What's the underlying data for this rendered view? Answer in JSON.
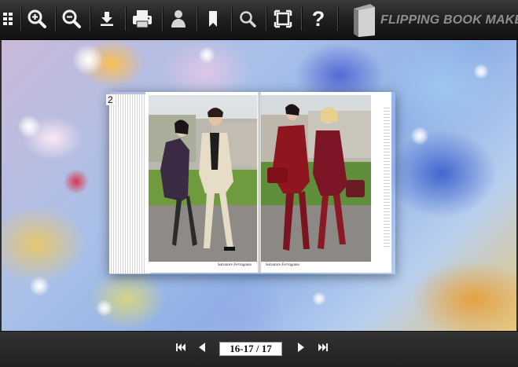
{
  "toolbar": {
    "buttons": [
      {
        "name": "thumbnails-icon"
      },
      {
        "name": "zoom-in-icon"
      },
      {
        "name": "zoom-out-icon"
      },
      {
        "name": "download-icon"
      },
      {
        "name": "print-icon"
      },
      {
        "name": "share-icon"
      },
      {
        "name": "bookmark-icon"
      },
      {
        "name": "search-icon"
      },
      {
        "name": "fullscreen-icon"
      },
      {
        "name": "help-icon",
        "glyph": "?"
      }
    ],
    "brand": {
      "text": "FLIPPING BOOK MAKER",
      "icon": "book-logo-icon"
    }
  },
  "book": {
    "page_stack_number": "2",
    "left_caption": "Salvatore Ferragamo",
    "right_caption": "Salvatore Ferragamo"
  },
  "navigation": {
    "first": {
      "icon": "first-page-icon"
    },
    "prev": {
      "icon": "prev-page-icon"
    },
    "page_indicator": "16-17 / 17",
    "next": {
      "icon": "next-page-icon"
    },
    "last": {
      "icon": "last-page-icon"
    }
  },
  "colors": {
    "toolbar_bg": "#1d1d1d",
    "icon": "#f2f2f2",
    "brand_text": "#8e8e8e",
    "bottombar_bg": "#262626"
  }
}
